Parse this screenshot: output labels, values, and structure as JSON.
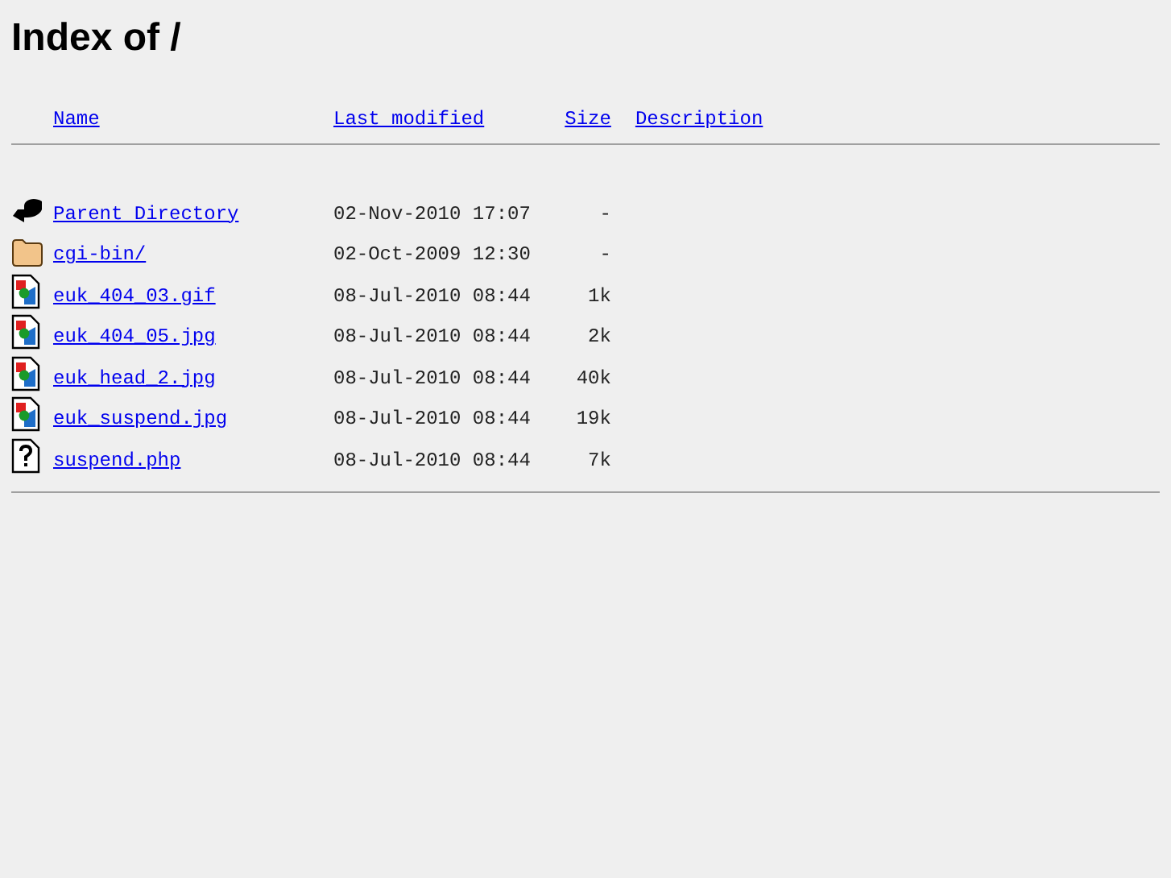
{
  "title": "Index of /",
  "columns": [
    "Name",
    "Last modified",
    "Size",
    "Description"
  ],
  "rows": [
    {
      "kind": "back",
      "name": "Parent Directory",
      "modified": "02-Nov-2010 17:07",
      "size": "-"
    },
    {
      "kind": "folder",
      "name": "cgi-bin/",
      "modified": "02-Oct-2009 12:30",
      "size": "-"
    },
    {
      "kind": "image",
      "name": "euk_404_03.gif",
      "modified": "08-Jul-2010 08:44",
      "size": "1k"
    },
    {
      "kind": "image",
      "name": "euk_404_05.jpg",
      "modified": "08-Jul-2010 08:44",
      "size": "2k"
    },
    {
      "kind": "image",
      "name": "euk_head_2.jpg",
      "modified": "08-Jul-2010 08:44",
      "size": "40k"
    },
    {
      "kind": "image",
      "name": "euk_suspend.jpg",
      "modified": "08-Jul-2010 08:44",
      "size": "19k"
    },
    {
      "kind": "unknown",
      "name": "suspend.php",
      "modified": "08-Jul-2010 08:44",
      "size": "7k"
    }
  ]
}
